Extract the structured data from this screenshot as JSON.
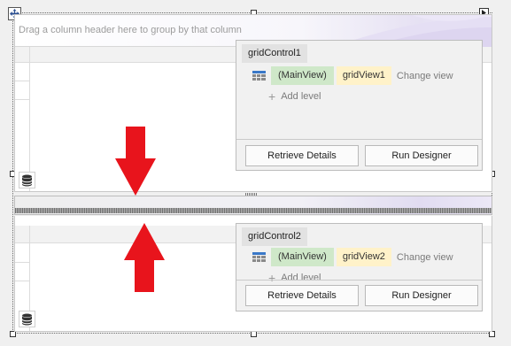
{
  "group_panel": {
    "hint": "Drag a column header here to group by that column"
  },
  "top_level_designer": {
    "control_name": "gridControl1",
    "main_view": "(MainView)",
    "view_name": "gridView1",
    "change_view": "Change view",
    "add_level": "Add level",
    "retrieve_details": "Retrieve Details",
    "run_designer": "Run Designer"
  },
  "bottom_level_designer": {
    "control_name": "gridControl2",
    "main_view": "(MainView)",
    "view_name": "gridView2",
    "change_view": "Change view",
    "add_level": "Add level",
    "retrieve_details": "Retrieve Details",
    "run_designer": "Run Designer"
  },
  "colors": {
    "arrow": "#e8141c",
    "main_view_pill": "#cfe8c9",
    "view_pill": "#fff2c9",
    "grid_icon": "#3a78c8"
  }
}
